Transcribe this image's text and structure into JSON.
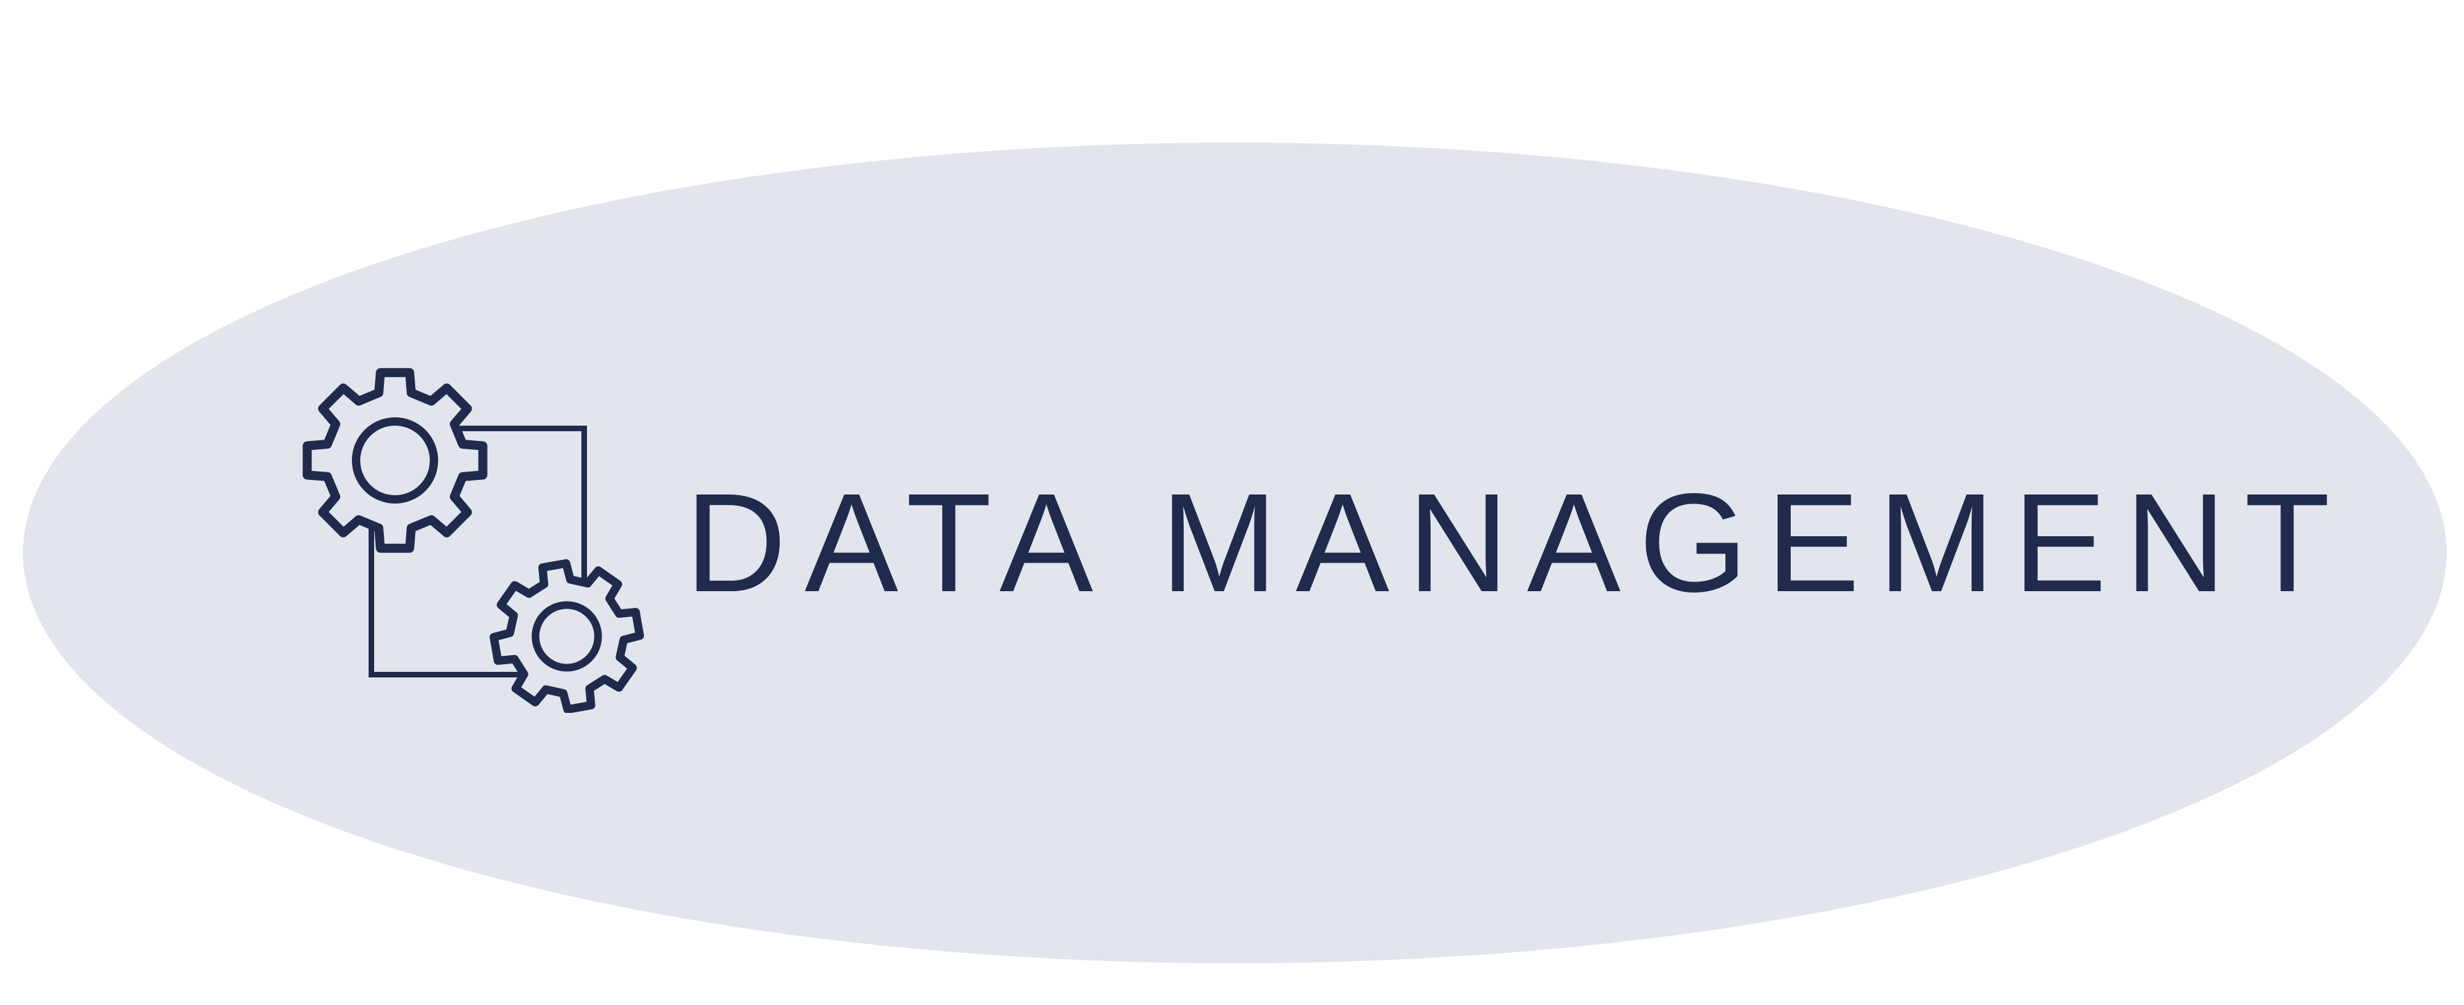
{
  "colors": {
    "background": "#ffffff",
    "ellipse": "#e2e6ec",
    "ink": "#1f2a4d"
  },
  "icon": {
    "name": "gears-icon"
  },
  "title": {
    "text": "DATA MANAGEMENT"
  }
}
